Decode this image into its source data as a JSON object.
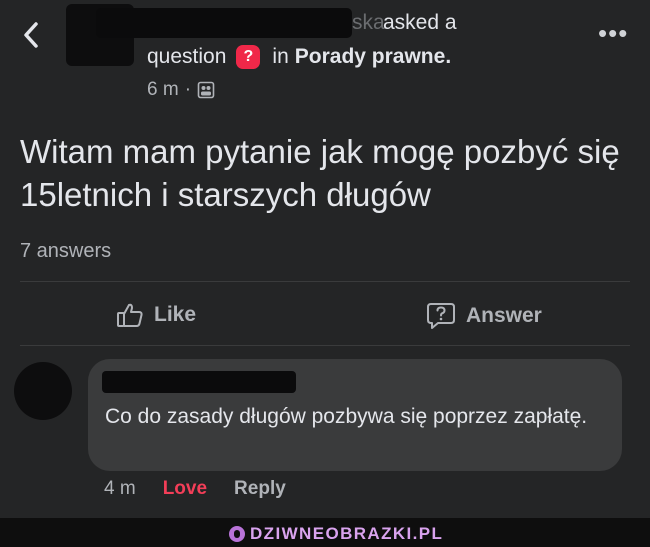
{
  "header": {
    "author_name_suffix": "ska",
    "asked_text": "asked a",
    "question_text": "question",
    "question_badge": "?",
    "in_text": "in",
    "group_name": "Porady prawne.",
    "time": "6 m",
    "separator": "·",
    "privacy_icon": "group-members-icon",
    "more_icon": "more-horizontal-icon"
  },
  "post": {
    "text": "Witam mam pytanie jak mogę pozbyć się 15letnich i starszych długów",
    "answers_count": "7 answers"
  },
  "actions": {
    "like_label": "Like",
    "answer_label": "Answer"
  },
  "comment": {
    "text": "Co do zasady długów pozbywa się poprzez zapłatę.",
    "time": "4 m",
    "reaction_label": "Love",
    "reply_label": "Reply"
  },
  "footer": {
    "watermark": "DZIWNEOBRAZKI.PL"
  },
  "colors": {
    "background": "#242526",
    "bubble": "#3a3b3c",
    "love": "#f33e58",
    "question_badge": "#f02849",
    "watermark": "#d9a3ee"
  }
}
